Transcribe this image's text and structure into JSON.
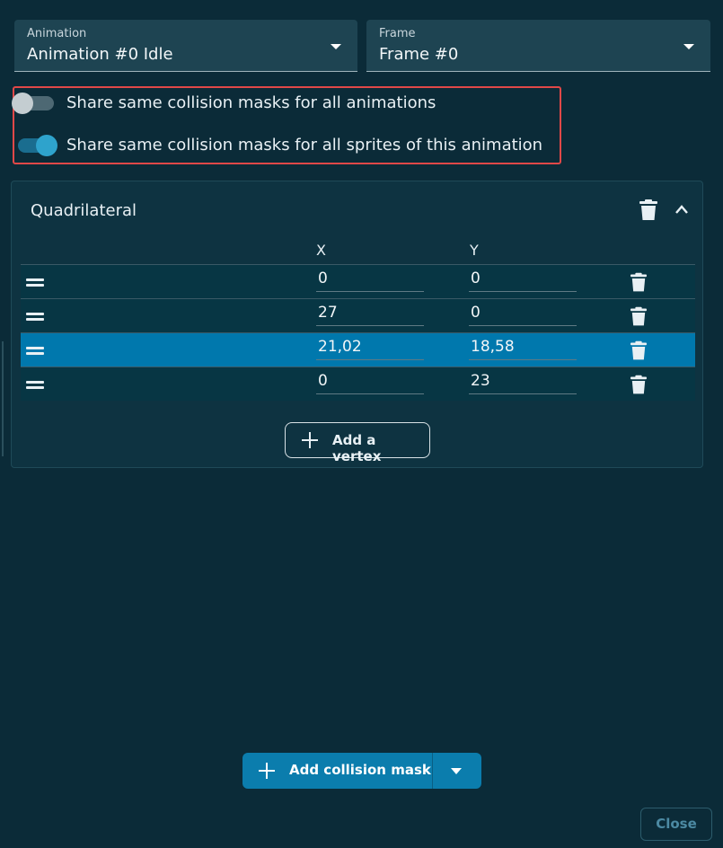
{
  "animation_select": {
    "label": "Animation",
    "value": "Animation #0 Idle"
  },
  "frame_select": {
    "label": "Frame",
    "value": "Frame #0"
  },
  "toggles": [
    {
      "label": "Share same collision masks for all animations",
      "checked": false
    },
    {
      "label": "Share same collision masks for all sprites of this animation",
      "checked": true
    }
  ],
  "mask_panel": {
    "title": "Quadrilateral",
    "columns": {
      "x": "X",
      "y": "Y"
    },
    "vertices": [
      {
        "x": "0",
        "y": "0"
      },
      {
        "x": "27",
        "y": "0"
      },
      {
        "x": "21,02",
        "y": "18,58",
        "selected": true
      },
      {
        "x": "0",
        "y": "23"
      }
    ],
    "add_vertex_label": "Add a vertex"
  },
  "add_mask_label": "Add collision mask",
  "close_label": "Close",
  "colors": {
    "accent": "#0b7dad",
    "selected_row": "#0078ad",
    "highlight": "#e04848",
    "background": "#0b2b38"
  }
}
